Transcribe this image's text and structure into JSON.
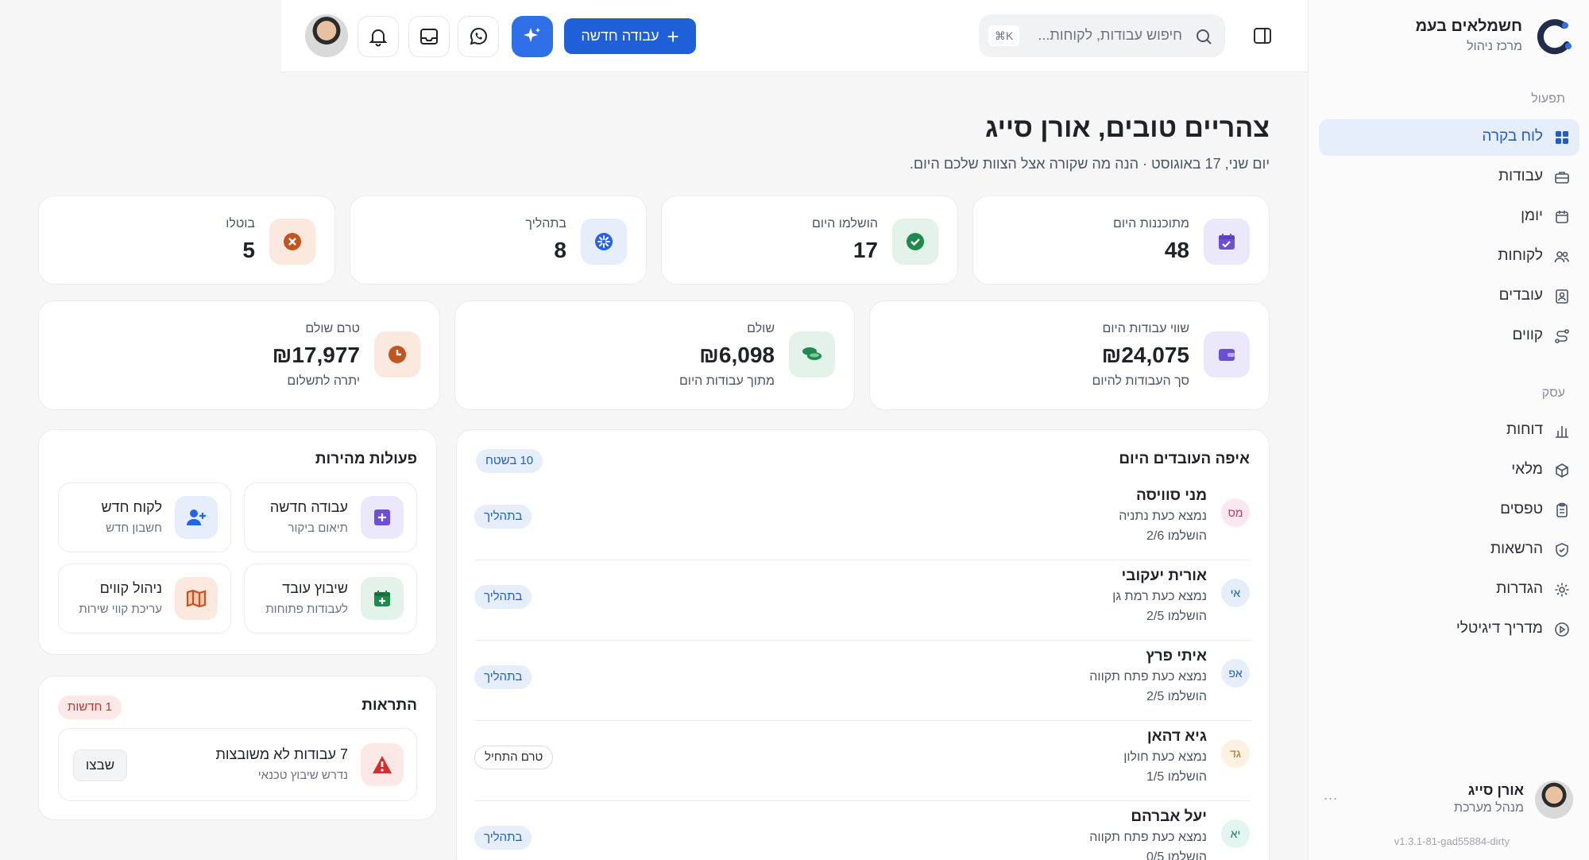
{
  "brand": {
    "name": "חשמלאים בעמ",
    "subtitle": "מרכז ניהול"
  },
  "sidebar": {
    "sections": [
      {
        "title": "תפעול",
        "items": [
          {
            "label": "לוח בקרה",
            "icon": "dashboard-icon",
            "active": true
          },
          {
            "label": "עבודות",
            "icon": "briefcase-icon"
          },
          {
            "label": "יומן",
            "icon": "calendar-icon"
          },
          {
            "label": "לקוחות",
            "icon": "users-icon"
          },
          {
            "label": "עובדים",
            "icon": "badge-icon"
          },
          {
            "label": "קווים",
            "icon": "route-icon"
          }
        ]
      },
      {
        "title": "עסק",
        "items": [
          {
            "label": "דוחות",
            "icon": "bar-chart-icon"
          },
          {
            "label": "מלאי",
            "icon": "package-icon"
          },
          {
            "label": "טפסים",
            "icon": "clipboard-icon"
          },
          {
            "label": "הרשאות",
            "icon": "shield-icon"
          },
          {
            "label": "הגדרות",
            "icon": "gear-icon"
          },
          {
            "label": "מדריך דיגיטלי",
            "icon": "play-circle-icon"
          }
        ]
      }
    ],
    "user": {
      "name": "אורן סייג",
      "role": "מנהל מערכת",
      "more": "..."
    },
    "version": "v1.3.1-81-gad55884-dirty"
  },
  "topbar": {
    "search_placeholder": "חיפוש עבודות, לקוחות...",
    "shortcut": "⌘K",
    "new_job_label": "עבודה חדשה"
  },
  "greeting": {
    "title": "צהריים טובים, אורן סייג",
    "subtitle": "יום שני, 17 באוגוסט · הנה מה שקורה אצל הצוות שלכם היום."
  },
  "stats": [
    {
      "label": "מתוכננות היום",
      "value": "48",
      "icon": "calendar-check-icon",
      "color": "#6d4fd6",
      "bg": "#ece8fb"
    },
    {
      "label": "הושלמו היום",
      "value": "17",
      "icon": "check-circle-icon",
      "color": "#1e8a4c",
      "bg": "#e3f3e9"
    },
    {
      "label": "בתהליך",
      "value": "8",
      "icon": "loader-icon",
      "color": "#2563eb",
      "bg": "#e6eefb"
    },
    {
      "label": "בוטלו",
      "value": "5",
      "icon": "x-circle-icon",
      "color": "#c2551f",
      "bg": "#fbe9df"
    }
  ],
  "money": [
    {
      "label": "שווי עבודות היום",
      "value": "₪24,075",
      "sub": "סך העבודות להיום",
      "icon": "wallet-icon",
      "color": "#6d4fd6",
      "bg": "#ece8fb"
    },
    {
      "label": "שולם",
      "value": "₪6,098",
      "sub": "מתוך עבודות היום",
      "icon": "coins-icon",
      "color": "#1e8a4c",
      "bg": "#e3f3e9"
    },
    {
      "label": "טרם שולם",
      "value": "₪17,977",
      "sub": "יתרה לתשלום",
      "icon": "clock-icon",
      "color": "#c2551f",
      "bg": "#fbe9df"
    }
  ],
  "workers": {
    "title": "איפה העובדים היום",
    "badge": "10 בשטח",
    "rows": [
      {
        "initials": "מס",
        "name": "מני סוויסה",
        "location": "נמצא כעת נתניה",
        "done": "הושלמו 2/6",
        "status": "בתהליך",
        "status_style": "blue",
        "avatar_bg": "#fde7ee",
        "avatar_color": "#c0356a"
      },
      {
        "initials": "אי",
        "name": "אורית יעקובי",
        "location": "נמצא כעת רמת גן",
        "done": "הושלמו 2/5",
        "status": "בתהליך",
        "status_style": "blue",
        "avatar_bg": "#e6eefb",
        "avatar_color": "#1f5fbf"
      },
      {
        "initials": "אפ",
        "name": "איתי פרץ",
        "location": "נמצא כעת פתח תקווה",
        "done": "הושלמו 2/5",
        "status": "בתהליך",
        "status_style": "blue",
        "avatar_bg": "#e6eefb",
        "avatar_color": "#1f5fbf"
      },
      {
        "initials": "גד",
        "name": "גיא דהאן",
        "location": "נמצא כעת חולון",
        "done": "הושלמו 1/5",
        "status": "טרם התחיל",
        "status_style": "outline",
        "avatar_bg": "#fdf1e2",
        "avatar_color": "#b26a1b"
      },
      {
        "initials": "יא",
        "name": "יעל אברהם",
        "location": "נמצא כעת פתח תקווה",
        "done": "הושלמו 0/5",
        "status": "בתהליך",
        "status_style": "blue",
        "avatar_bg": "#e2f5f1",
        "avatar_color": "#17806b"
      }
    ]
  },
  "quick_actions": {
    "title": "פעולות מהירות",
    "items": [
      {
        "title": "עבודה חדשה",
        "sub": "תיאום ביקור",
        "icon": "plus-square-icon",
        "color": "#6d4fd6",
        "bg": "#ece8fb"
      },
      {
        "title": "לקוח חדש",
        "sub": "חשבון חדש",
        "icon": "user-plus-icon",
        "color": "#2563eb",
        "bg": "#e6eefb"
      },
      {
        "title": "שיבוץ עובד",
        "sub": "לעבודות פתוחות",
        "icon": "calendar-plus-icon",
        "color": "#1e8a4c",
        "bg": "#e3f3e9"
      },
      {
        "title": "ניהול קווים",
        "sub": "עריכת קווי שירות",
        "icon": "map-icon",
        "color": "#c2551f",
        "bg": "#fbe9df"
      }
    ]
  },
  "alerts": {
    "title": "התראות",
    "badge": "1 חדשות",
    "items": [
      {
        "title": "7 עבודות לא משובצות",
        "sub": "נדרש שיבוץ טכנאי",
        "action": "שבצו",
        "icon": "warning-triangle-icon"
      }
    ]
  }
}
